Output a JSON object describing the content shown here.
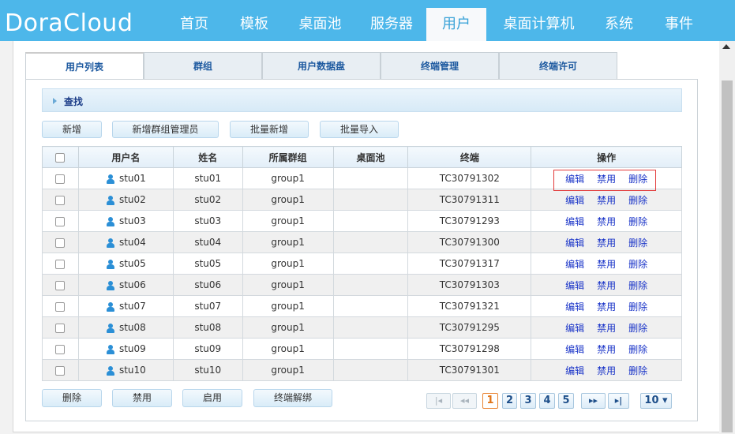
{
  "app": {
    "logo": "DoraCloud"
  },
  "nav": [
    "首页",
    "模板",
    "桌面池",
    "服务器",
    "用户",
    "桌面计算机",
    "系统",
    "事件"
  ],
  "tabs": [
    "用户列表",
    "群组",
    "用户数据盘",
    "终端管理",
    "终端许可"
  ],
  "search": {
    "label": "查找"
  },
  "toolbar": {
    "add": "新增",
    "add_group_admin": "新增群组管理员",
    "batch_add": "批量新增",
    "batch_import": "批量导入"
  },
  "table": {
    "headers": {
      "username": "用户名",
      "name": "姓名",
      "group": "所属群组",
      "pool": "桌面池",
      "terminal": "终端",
      "actions": "操作"
    },
    "action_labels": {
      "edit": "编辑",
      "disable": "禁用",
      "delete": "删除"
    },
    "rows": [
      {
        "username": "stu01",
        "name": "stu01",
        "group": "group1",
        "pool": "",
        "terminal": "TC30791302"
      },
      {
        "username": "stu02",
        "name": "stu02",
        "group": "group1",
        "pool": "",
        "terminal": "TC30791311"
      },
      {
        "username": "stu03",
        "name": "stu03",
        "group": "group1",
        "pool": "",
        "terminal": "TC30791293"
      },
      {
        "username": "stu04",
        "name": "stu04",
        "group": "group1",
        "pool": "",
        "terminal": "TC30791300"
      },
      {
        "username": "stu05",
        "name": "stu05",
        "group": "group1",
        "pool": "",
        "terminal": "TC30791317"
      },
      {
        "username": "stu06",
        "name": "stu06",
        "group": "group1",
        "pool": "",
        "terminal": "TC30791303"
      },
      {
        "username": "stu07",
        "name": "stu07",
        "group": "group1",
        "pool": "",
        "terminal": "TC30791321"
      },
      {
        "username": "stu08",
        "name": "stu08",
        "group": "group1",
        "pool": "",
        "terminal": "TC30791295"
      },
      {
        "username": "stu09",
        "name": "stu09",
        "group": "group1",
        "pool": "",
        "terminal": "TC30791298"
      },
      {
        "username": "stu10",
        "name": "stu10",
        "group": "group1",
        "pool": "",
        "terminal": "TC30791301"
      }
    ]
  },
  "bottom_actions": {
    "delete": "删除",
    "disable": "禁用",
    "enable": "启用",
    "unbind_terminal": "终端解绑"
  },
  "pagination": {
    "first": "|◂",
    "prev": "◂◂",
    "pages": [
      "1",
      "2",
      "3",
      "4",
      "5"
    ],
    "current": "1",
    "next": "▸▸",
    "last": "▸|",
    "page_size": "10 ▾"
  },
  "colors": {
    "header_blue": "#4db7ea",
    "link_blue": "#1a34c8",
    "highlight_red": "#e23a3a"
  }
}
